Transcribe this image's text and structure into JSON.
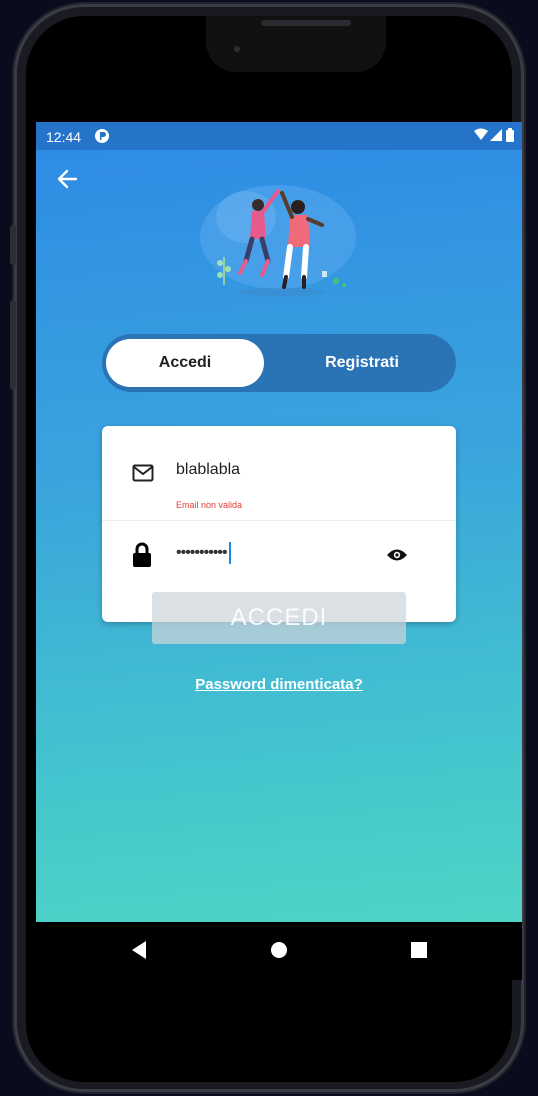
{
  "status_bar": {
    "time": "12:44"
  },
  "toggle": {
    "login_label": "Accedi",
    "register_label": "Registrati"
  },
  "form": {
    "email_value": "blablabla",
    "email_error": "Email non valida",
    "password_value": "•••••••••••"
  },
  "login_button_label": "ACCEDI",
  "forgot_password_label": "Password dimenticata?",
  "icons": {
    "back": "arrow-left-icon",
    "email": "mail-icon",
    "password": "lock-icon",
    "show_password": "eye-icon",
    "nav_back": "triangle-back-icon",
    "nav_home": "circle-home-icon",
    "nav_recents": "square-recents-icon"
  },
  "colors": {
    "gradient_top": "#2d8ae6",
    "gradient_bottom": "#4fd4c6",
    "status_bar": "#2574c9",
    "error": "#e53935"
  }
}
